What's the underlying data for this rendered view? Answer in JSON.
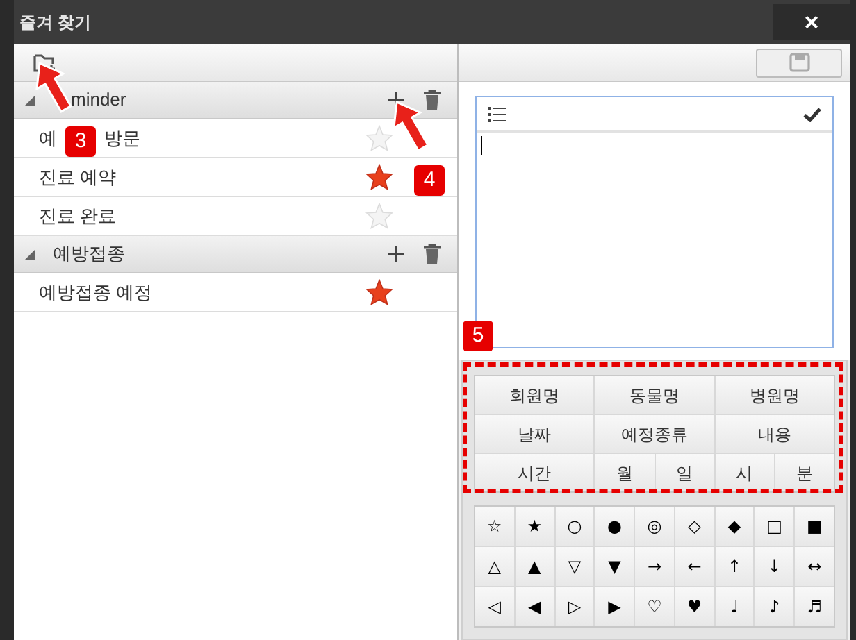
{
  "window": {
    "title": "즐겨 찾기",
    "close": "×"
  },
  "groups": [
    {
      "name": "minder",
      "expanded": true,
      "items": [
        {
          "name_fragments": [
            "예",
            "방문"
          ],
          "favorite": false
        },
        {
          "name": "진료 예약",
          "favorite": true
        },
        {
          "name": "진료 완료",
          "favorite": false
        }
      ]
    },
    {
      "name": "예방접종",
      "expanded": true,
      "items": [
        {
          "name": "예방접종 예정",
          "favorite": true
        }
      ]
    }
  ],
  "tag_buttons": [
    {
      "label": "회원명",
      "kind": "wide"
    },
    {
      "label": "동물명",
      "kind": "wide"
    },
    {
      "label": "병원명",
      "kind": "wide"
    },
    {
      "label": "날짜",
      "kind": "wide"
    },
    {
      "label": "예정종류",
      "kind": "wide"
    },
    {
      "label": "내용",
      "kind": "wide"
    },
    {
      "label": "시간",
      "kind": "wide"
    },
    {
      "label": "월",
      "kind": "half"
    },
    {
      "label": "일",
      "kind": "half"
    },
    {
      "label": "시",
      "kind": "half"
    },
    {
      "label": "분",
      "kind": "half"
    }
  ],
  "symbols": [
    "☆",
    "★",
    "○",
    "●",
    "◎",
    "◇",
    "◆",
    "□",
    "■",
    "△",
    "▲",
    "▽",
    "▼",
    "→",
    "←",
    "↑",
    "↓",
    "↔",
    "◁",
    "◀",
    "▷",
    "▶",
    "♡",
    "♥",
    "♩",
    "♪",
    "♬"
  ],
  "callouts": [
    "3",
    "4",
    "5"
  ]
}
